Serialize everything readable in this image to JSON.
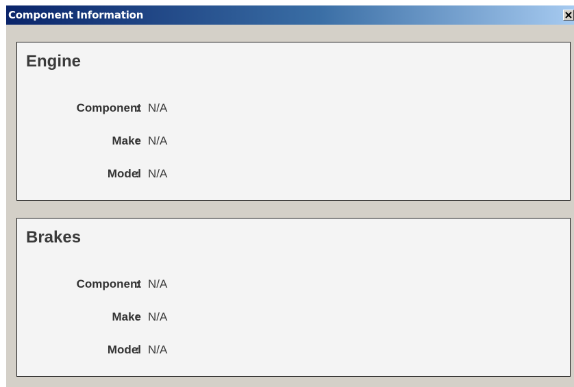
{
  "window": {
    "title": "Component Information"
  },
  "panels": [
    {
      "title": "Engine",
      "fields": [
        {
          "label": "Component",
          "value": "N/A"
        },
        {
          "label": "Make",
          "value": "N/A"
        },
        {
          "label": "Model",
          "value": "N/A"
        }
      ]
    },
    {
      "title": "Brakes",
      "fields": [
        {
          "label": "Component",
          "value": "N/A"
        },
        {
          "label": "Make",
          "value": "N/A"
        },
        {
          "label": "Model",
          "value": "N/A"
        }
      ]
    }
  ],
  "icons": {
    "close": "close-icon"
  },
  "colors": {
    "titlebar_start": "#0a246a",
    "titlebar_end": "#a6caf0",
    "window_bg": "#d4d0c8",
    "panel_bg": "#f4f4f4"
  }
}
